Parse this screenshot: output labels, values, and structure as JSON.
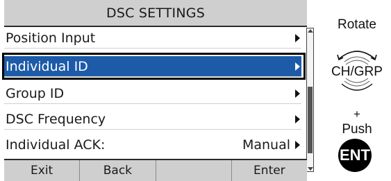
{
  "screen": {
    "title": "DSC SETTINGS",
    "menu_items": [
      {
        "label": "Position Input",
        "value": "",
        "has_arrow": true
      },
      {
        "label": "Individual ID",
        "value": "",
        "has_arrow": true,
        "selected": true
      },
      {
        "label": "Group ID",
        "value": "",
        "has_arrow": true
      },
      {
        "label": "DSC Frequency",
        "value": "",
        "has_arrow": true
      },
      {
        "label": "Individual ACK:",
        "value": "Manual",
        "has_arrow": true
      }
    ],
    "softkeys": [
      "Exit",
      "Back",
      "",
      "Enter"
    ],
    "colors": {
      "selected_bg": "#1d5ba8",
      "bar_bg": "#cfcfcf"
    }
  },
  "instructions": {
    "rotate_label": "Rotate",
    "knob_label": "CH/GRP",
    "plus_label": "+",
    "push_label": "Push",
    "ent_label": "ENT"
  }
}
